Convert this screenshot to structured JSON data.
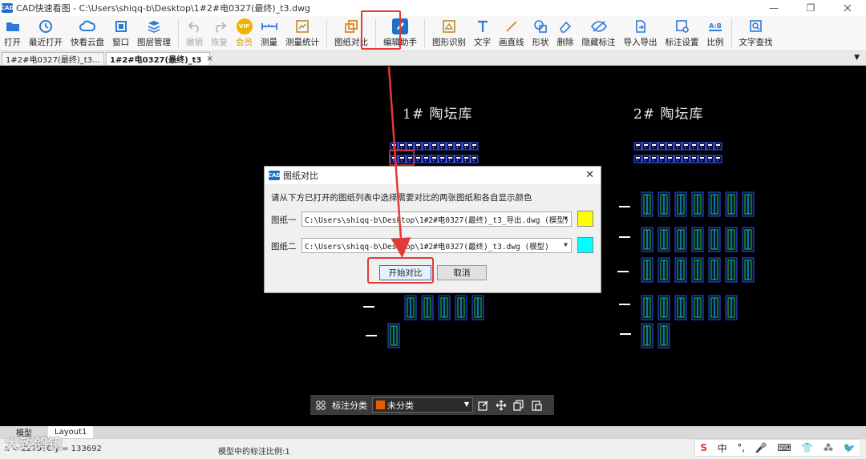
{
  "window": {
    "logo": "CAD",
    "title": "CAD快速看图 - C:\\Users\\shiqq-b\\Desktop\\1#2#电0327(最终)_t3.dwg",
    "minimize": "—",
    "restore": "❐"
  },
  "toolbar": {
    "open": "打开",
    "recent": "最近打开",
    "cloud": "快看云盘",
    "window": "窗口",
    "layers": "图层管理",
    "undo": "撤销",
    "redo": "恢复",
    "vip_badge": "VIP",
    "vip": "会员",
    "measure": "测量",
    "measure_stats": "测量统计",
    "compare": "图纸对比",
    "edit_assist": "编辑助手",
    "recognize": "图形识别",
    "text": "文字",
    "line": "画直线",
    "shape": "形状",
    "delete": "删除",
    "hide_annot": "隐藏标注",
    "import_export": "导入导出",
    "annot_settings": "标注设置",
    "ratio": "比例",
    "ratio_icon_text": "A:B",
    "find_text": "文字查找"
  },
  "tabs": [
    {
      "label": "1#2#电0327(最终)_t3…",
      "close": "×"
    },
    {
      "label": "1#2#电0327(最终)_t3",
      "close": "×"
    }
  ],
  "tab_menu": "▼",
  "canvas": {
    "title_left": "1# 陶坛库",
    "title_right": "2# 陶坛库"
  },
  "model_tabs": [
    "模型",
    "Layout1"
  ],
  "status": {
    "coord": "x = 227970  y = 133692",
    "scale": "模型中的标注比例:1"
  },
  "watermark": "大致鸽镜",
  "ime": [
    "S",
    "中",
    "°,",
    "🎤",
    "⌨",
    "👕",
    "⁂",
    "🐦"
  ],
  "annot_bar": {
    "label": "标注分类",
    "selected": "未分类"
  },
  "dialog": {
    "title": "图纸对比",
    "close": "✕",
    "instruction": "请从下方已打开的图纸列表中选择需要对比的两张图纸和各自显示颜色",
    "drawing1_label": "图纸一",
    "drawing1_value": "C:\\Users\\shiqq-b\\Desktop\\1#2#电0327(最终)_t3_导出.dwg (模型)",
    "drawing1_color": "#ffff00",
    "drawing2_label": "图纸二",
    "drawing2_value": "C:\\Users\\shiqq-b\\Desktop\\1#2#电0327(最终)_t3.dwg (模型)",
    "drawing2_color": "#00ffff",
    "start": "开始对比",
    "cancel": "取消"
  },
  "colors": {
    "highlight": "#e53935",
    "canvas_bg": "#000000",
    "accent": "#1e6fc8"
  }
}
